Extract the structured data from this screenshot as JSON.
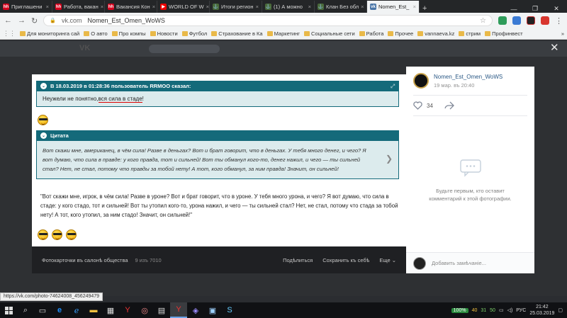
{
  "browser": {
    "tabs": [
      {
        "label": "Приглашени",
        "fav": "hh",
        "color": "#d6001c"
      },
      {
        "label": "Работа, вакан",
        "fav": "hh",
        "color": "#d6001c"
      },
      {
        "label": "Вакансия Кон",
        "fav": "hh",
        "color": "#d6001c"
      },
      {
        "label": "WORLD OF W",
        "fav": "▶",
        "color": "#e00"
      },
      {
        "label": "Итоги регион",
        "fav": "⚓",
        "color": "#4a6a3a"
      },
      {
        "label": "(1) А можно",
        "fav": "⚓",
        "color": "#4a6a3a"
      },
      {
        "label": "Клан Без обл",
        "fav": "⚓",
        "color": "#4a6a3a"
      },
      {
        "label": "Nomen_Est_",
        "fav": "vk",
        "color": "#4a76a8"
      }
    ],
    "new_tab": "+",
    "win_min": "—",
    "win_max": "❐",
    "win_close": "✕",
    "back": "←",
    "forward": "→",
    "reload": "↻",
    "lock": "🔒",
    "url_host": "vk.com",
    "url_title": "Nomen_Est_Omen_WoWS",
    "star": "☆",
    "menu": "⋮",
    "bookmarks": [
      "Для мониторинга сай",
      "О авто",
      "Про компы",
      "Новости",
      "Футбол",
      "Страхование в Ка",
      "Маркетинг",
      "Социальные сети",
      "Работа",
      "Прочее",
      "vannaeva.kz",
      "стрим",
      "Профинвест"
    ],
    "bookmarks_more": "»"
  },
  "forum": {
    "quote1_header": "В 18.03.2019 в 01:28:36 пользователь RRMOO сказал:",
    "quote1_text_a": "Неужели не понятно,",
    "quote1_text_b": "вся сила в стаде",
    "quote1_text_c": "!",
    "quote2_header": "Цитата",
    "quote2_text": "Вот скажи мне, американец, в чём сила! Разве в деньгах? Вот и брат говорит, что в деньгах. У тебя много денег, и чего? Я вот думаю, что сила в правде: у кого правда, тот и сильней! Вот ты обманул кого-то, денег нажил, и чего — ты сильней стал? Нет, не стал, потому что правды за тобой нету! А тот, кого обманул, за ним правда! Значит, он сильней!",
    "reply_text": "\"Вот скажи мне, игрок, в чём сила! Разве в уроне? Вот и брат говорит, что в уроне. У тебя много урона, и чего? Я вот думаю, что сила в стаде: у кого стадо, тот и сильней! Вот ты утопил кого-то, урона нажил, и чего — ты сильней стал? Нет, не стал, потому что стада за тобой нету! А тот, кого утопил, за ним стадо! Значит, он сильней!\"",
    "expand_icon": "⤢",
    "next_arrow": "❯"
  },
  "photo_bar": {
    "album": "Фотокарточки въ салонѣ общества",
    "counter": "9 изъ 7010",
    "share": "Подѣлиться",
    "save": "Сохранить къ себѣ",
    "more": "Еще ⌄"
  },
  "side": {
    "author": "Nomen_Est_Omen_WoWS",
    "date": "19 мар. въ 20:40",
    "likes": "34",
    "empty_line1": "Будьте первым, кто оставит",
    "empty_line2": "комментарий к этой фотографии.",
    "comment_placeholder": "Добавить замѣчаніе..."
  },
  "status_url": "https://vk.com/photo-74624008_456249479",
  "taskbar": {
    "battery": "100%",
    "tray_nums": [
      "40",
      "31",
      "50"
    ],
    "lang": "РУС",
    "time": "21:42",
    "date": "25.03.2019"
  }
}
